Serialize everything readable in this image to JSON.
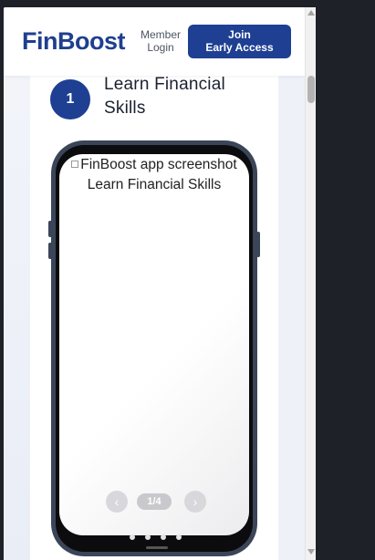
{
  "header": {
    "logo": "FinBoost",
    "member_line1": "Member",
    "member_line2": "Login",
    "join_line1": "Join",
    "join_line2": "Early Access"
  },
  "step": {
    "number": "1",
    "title": "Learn Financial Skills"
  },
  "phone": {
    "alt_line1": "FinBoost app screenshot",
    "alt_line2": "Learn Financial Skills",
    "prev_icon": "‹",
    "next_icon": "›",
    "counter": "1/4",
    "dots_count": 4,
    "active_dot": 1
  },
  "colors": {
    "brand": "#1e3f92",
    "page_bg": "#eef1f8",
    "phone_frame": "#3b4558"
  }
}
